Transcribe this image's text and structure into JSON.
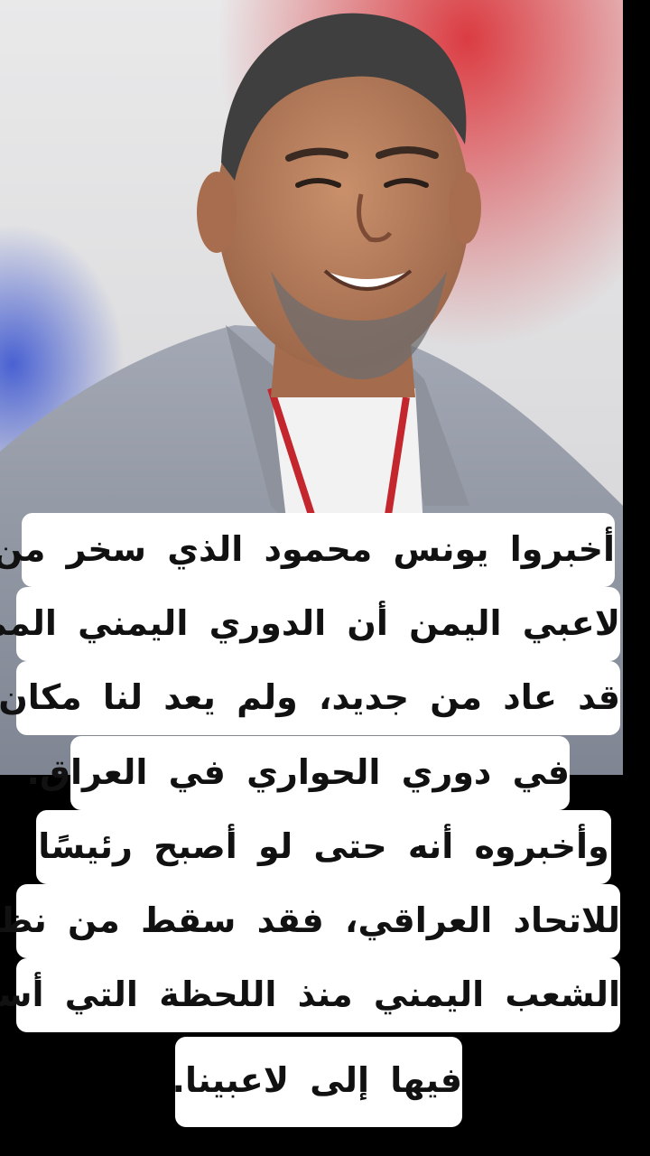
{
  "photo": {
    "subject_icon": "portrait-photo"
  },
  "caption": {
    "lines": [
      "أخبروا يونس محمود الذي سخر من",
      "لاعبي اليمن أن الدوري اليمني الممتاز",
      "قد عاد من جديد، ولم يعد لنا مكان",
      "في دوري الحواري في العراق.",
      "وأخبروه أنه حتى لو أصبح رئيسًا",
      "للاتحاد العراقي، فقد سقط من نظر",
      "الشعب اليمني منذ اللحظة التي أساء",
      "فيها إلى لاعبينا."
    ]
  },
  "colors": {
    "background": "#000000",
    "caption_box": "#ffffff",
    "caption_text": "#111111"
  }
}
